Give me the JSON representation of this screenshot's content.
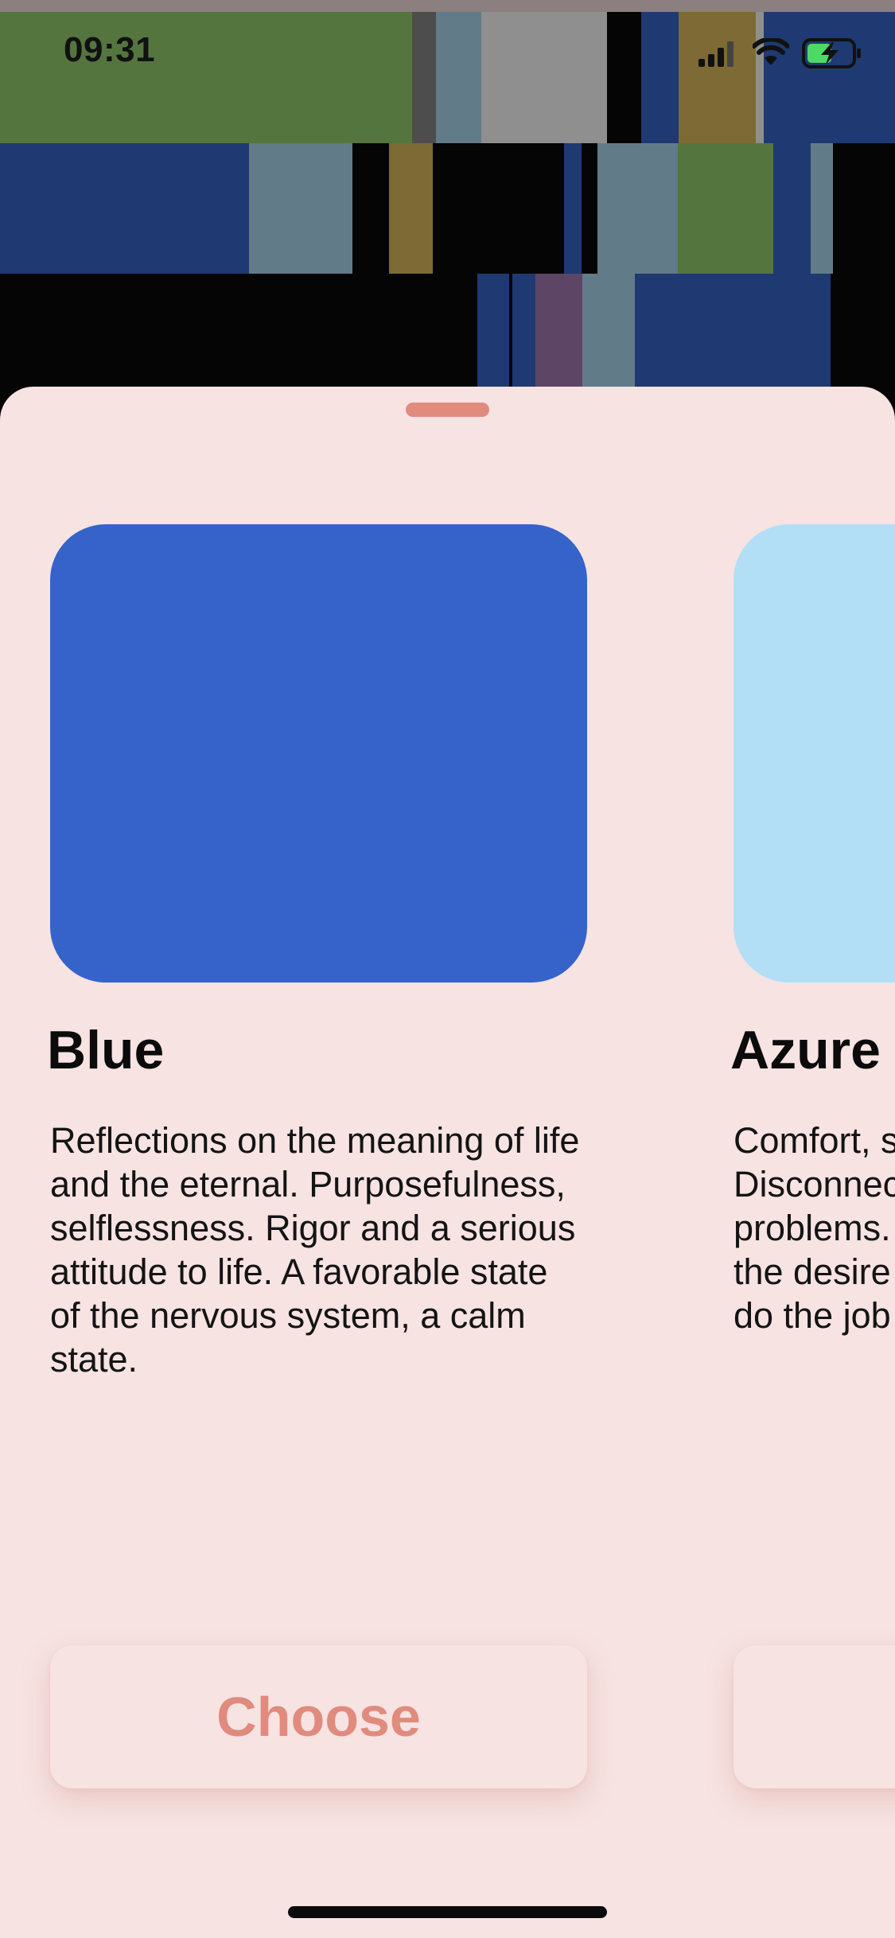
{
  "status_bar": {
    "time": "09:31",
    "icons": [
      "signal-icon",
      "wifi-icon",
      "battery-charging-icon"
    ]
  },
  "sheet": {
    "colors": {
      "background": "#f6e3e2",
      "accent": "#e08b7d",
      "text": "#0b0b0b"
    },
    "cards": [
      {
        "name": "Blue",
        "swatch_color": "#3663ca",
        "description": "Reflections on the meaning of life and the eternal. Purposefulness, selflessness. Rigor and a serious attitude to life. A favorable state of the nervous system, a calm state.",
        "button_label": "Choose"
      },
      {
        "name": "Azure",
        "swatch_color": "#b2dff6",
        "description": "Comfort, s\nDisconnec\nproblems.\nthe desire\ndo the job",
        "button_label": ""
      }
    ]
  },
  "background_colors": [
    "#55753f",
    "#1f3a72",
    "#627b89",
    "#8f8f8f",
    "#7d6a34",
    "#5d4566",
    "#4d4d4d"
  ]
}
